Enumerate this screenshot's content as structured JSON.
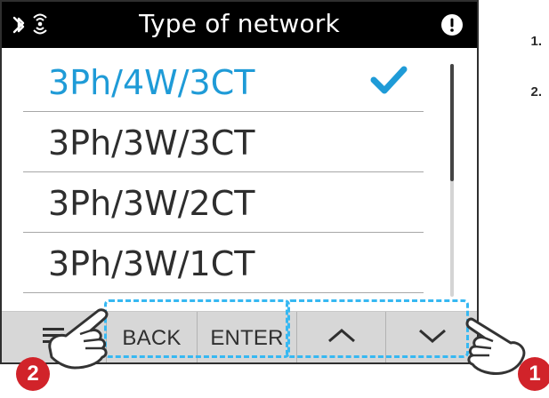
{
  "header": {
    "title": "Type of network",
    "icons": {
      "bluetooth": "bluetooth-icon",
      "signal": "signal-icon",
      "alert": "alert-icon"
    }
  },
  "list": {
    "items": [
      {
        "label": "3Ph/4W/3CT",
        "selected": true
      },
      {
        "label": "3Ph/3W/3CT",
        "selected": false
      },
      {
        "label": "3Ph/3W/2CT",
        "selected": false
      },
      {
        "label": "3Ph/3W/1CT",
        "selected": false
      }
    ]
  },
  "buttons": {
    "menu": {
      "icon": "menu-icon"
    },
    "back": {
      "label": "BACK"
    },
    "enter": {
      "label": "ENTER"
    },
    "up": {
      "icon": "chevron-up-icon"
    },
    "down": {
      "icon": "chevron-down-icon"
    }
  },
  "annotations": {
    "badges": [
      "2",
      "1"
    ],
    "side_steps": [
      "1.",
      "2."
    ]
  },
  "colors": {
    "accent": "#1f9bd7",
    "badge": "#d1232a",
    "dashed": "#36b8f2",
    "header": "#000000",
    "button_bar": "#d7d7d7"
  }
}
